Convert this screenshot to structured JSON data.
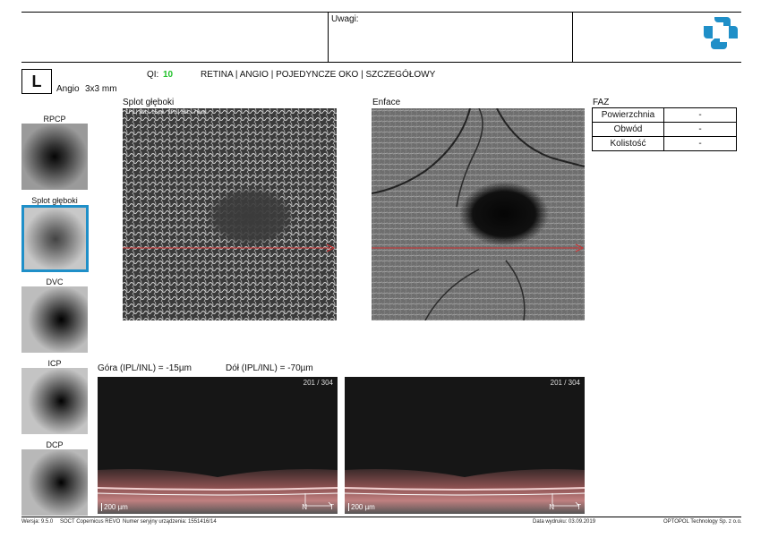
{
  "header": {
    "notes_label": "Uwagi:",
    "eye": "L",
    "scan_type": "Angio",
    "scan_size": "3x3 mm",
    "qi_label": "QI:",
    "qi_value": "10",
    "mode_line": "RETINA | ANGIO | POJEDYNCZE OKO | SZCZEGÓŁOWY"
  },
  "thumbnails": [
    {
      "label": "RPCP"
    },
    {
      "label": "Splot głęboki"
    },
    {
      "label": "DVC"
    },
    {
      "label": "ICP"
    },
    {
      "label": "DCP"
    }
  ],
  "main_images": {
    "left_title": "Splot głęboki",
    "left_overlay": "IPL|INL-15µm  IPL|INL-70µm",
    "right_title": "Enface"
  },
  "faz": {
    "title": "FAZ",
    "rows": [
      {
        "key": "Powierzchnia",
        "value": "-"
      },
      {
        "key": "Obwód",
        "value": "-"
      },
      {
        "key": "Kolistość",
        "value": "-"
      }
    ]
  },
  "layers": {
    "top": "Góra (IPL/INL) = -15µm",
    "bottom": "Dół (IPL/INL) = -70µm"
  },
  "bscans": [
    {
      "counter": "201 / 304",
      "scale": "200 µm",
      "n": "N",
      "t": "T"
    },
    {
      "counter": "201 / 304",
      "scale": "200 µm",
      "n": "N",
      "t": "T"
    }
  ],
  "footer": {
    "version": "Wersja: 9.5.0",
    "device": "SOCT Copernicus REVO",
    "serial": "Numer seryjny urządzenia: 1551416/14",
    "print_date": "Data wydruku: 03.09.2019",
    "company": "OPTOPOL Technology Sp. z o.o."
  },
  "colors": {
    "accent": "#1f8fc8",
    "qi": "#22c12b",
    "scan_line": "#d03030"
  }
}
